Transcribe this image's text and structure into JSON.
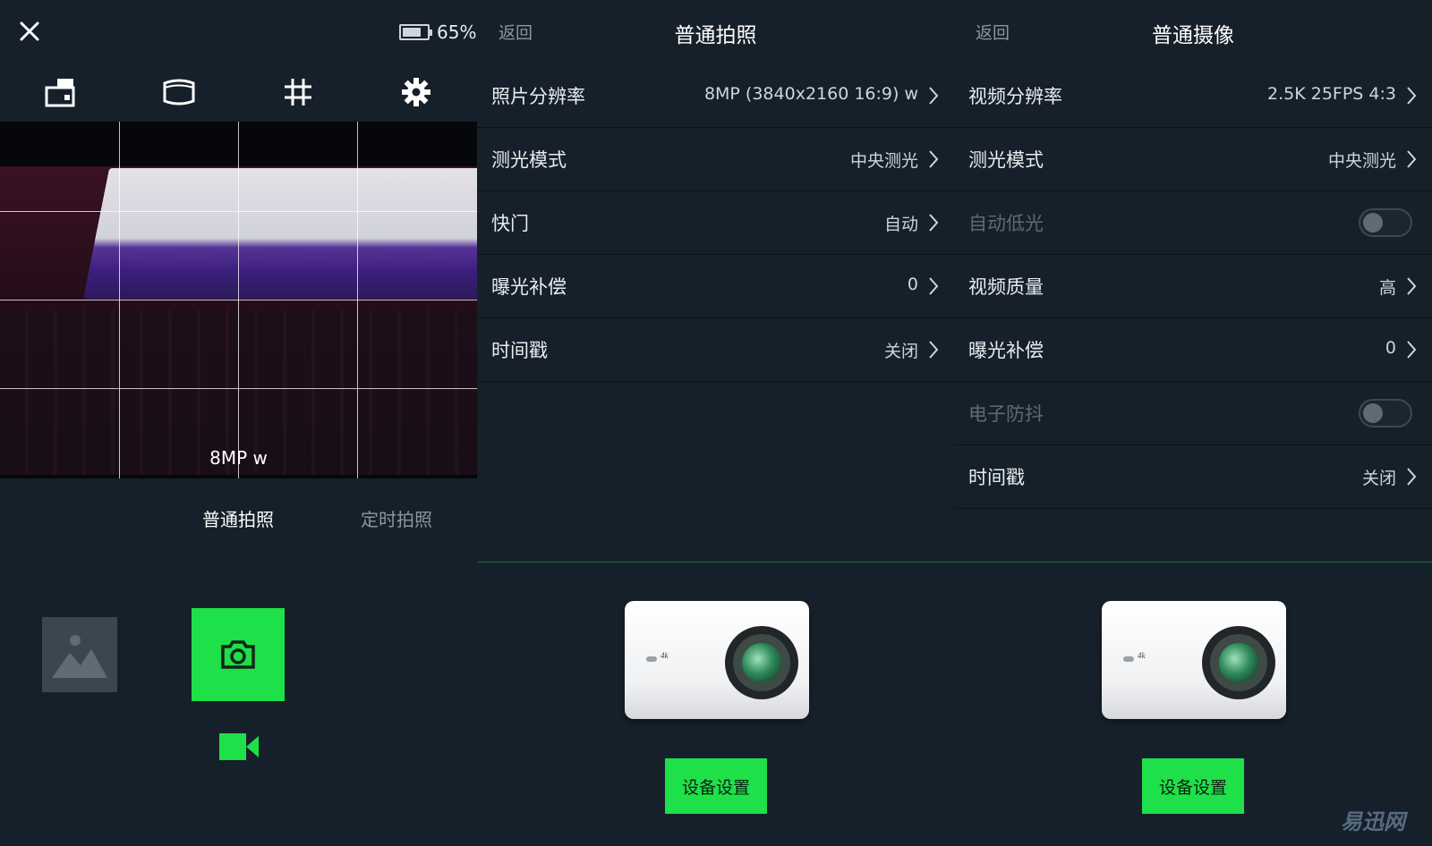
{
  "camera": {
    "battery_percent": 65,
    "battery_label": "65%",
    "resolution_overlay": "8MP w",
    "modes": [
      {
        "label": "普通拍照",
        "active": true
      },
      {
        "label": "定时拍照",
        "active": false
      }
    ],
    "icons": {
      "close": "close-icon",
      "tools": [
        "camera-mode-icon",
        "wide-angle-icon",
        "grid-icon",
        "settings-gear-icon"
      ],
      "gallery": "gallery-image-icon",
      "shutter": "camera-shutter-icon",
      "video": "video-camera-icon"
    },
    "accent": "#1ee048"
  },
  "photo_settings": {
    "back": "返回",
    "title": "普通拍照",
    "rows": [
      {
        "label": "照片分辨率",
        "value": "8MP (3840x2160 16:9) w"
      },
      {
        "label": "测光模式",
        "value": "中央测光"
      },
      {
        "label": "快门",
        "value": "自动"
      },
      {
        "label": "曝光补偿",
        "value": "0"
      },
      {
        "label": "时间戳",
        "value": "关闭"
      }
    ],
    "device_button": "设备设置"
  },
  "video_settings": {
    "back": "返回",
    "title": "普通摄像",
    "rows": [
      {
        "label": "视频分辨率",
        "value": "2.5K 25FPS 4:3"
      },
      {
        "label": "测光模式",
        "value": "中央测光"
      },
      {
        "label": "自动低光",
        "toggle": false
      },
      {
        "label": "视频质量",
        "value": "高"
      },
      {
        "label": "曝光补偿",
        "value": "0"
      },
      {
        "label": "电子防抖",
        "toggle": false
      },
      {
        "label": "时间戳",
        "value": "关闭"
      }
    ],
    "device_button": "设备设置"
  },
  "camera_art_text": "4k",
  "watermark": "易迅网"
}
